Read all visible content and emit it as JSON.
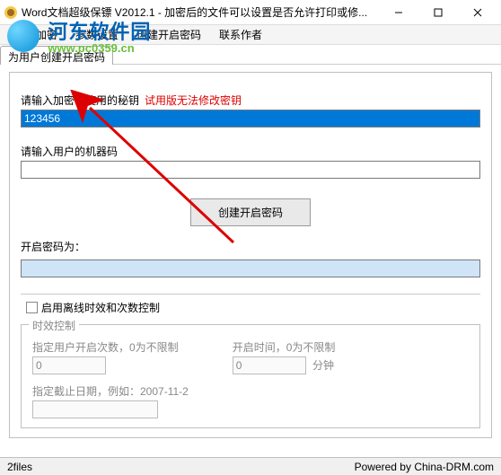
{
  "window": {
    "title": "Word文档超级保镖 V2012.1 - 加密后的文件可以设置是否允许打印或修..."
  },
  "watermark": {
    "text": "河东软件园",
    "url": "www.pc0359.cn"
  },
  "menu": {
    "file_encrypt": "文件加密",
    "param_settings": "参数设置",
    "create_open_pw": "创建开启密码",
    "contact_author": "联系作者"
  },
  "tab": {
    "create_pw_for_user": "为用户创建开启密码"
  },
  "labels": {
    "enter_secret": "请输入加密时使用的秘钥",
    "trial_note": "试用版无法修改密钥",
    "enter_machine_code": "请输入用户的机器码",
    "create_btn": "创建开启密码",
    "open_pw_is": "开启密码为：",
    "enable_offline": "启用离线时效和次数控制",
    "time_control": "时效控制",
    "open_count": "指定用户开启次数，0为不限制",
    "open_time": "开启时间，0为不限制",
    "minutes": "分钟",
    "deadline": "指定截止日期，例如：2007-11-2"
  },
  "values": {
    "secret": "123456",
    "machine_code": "",
    "open_pw": "",
    "count": "0",
    "time": "0",
    "deadline": ""
  },
  "status": {
    "left": "2files",
    "right": "Powered by China-DRM.com"
  }
}
